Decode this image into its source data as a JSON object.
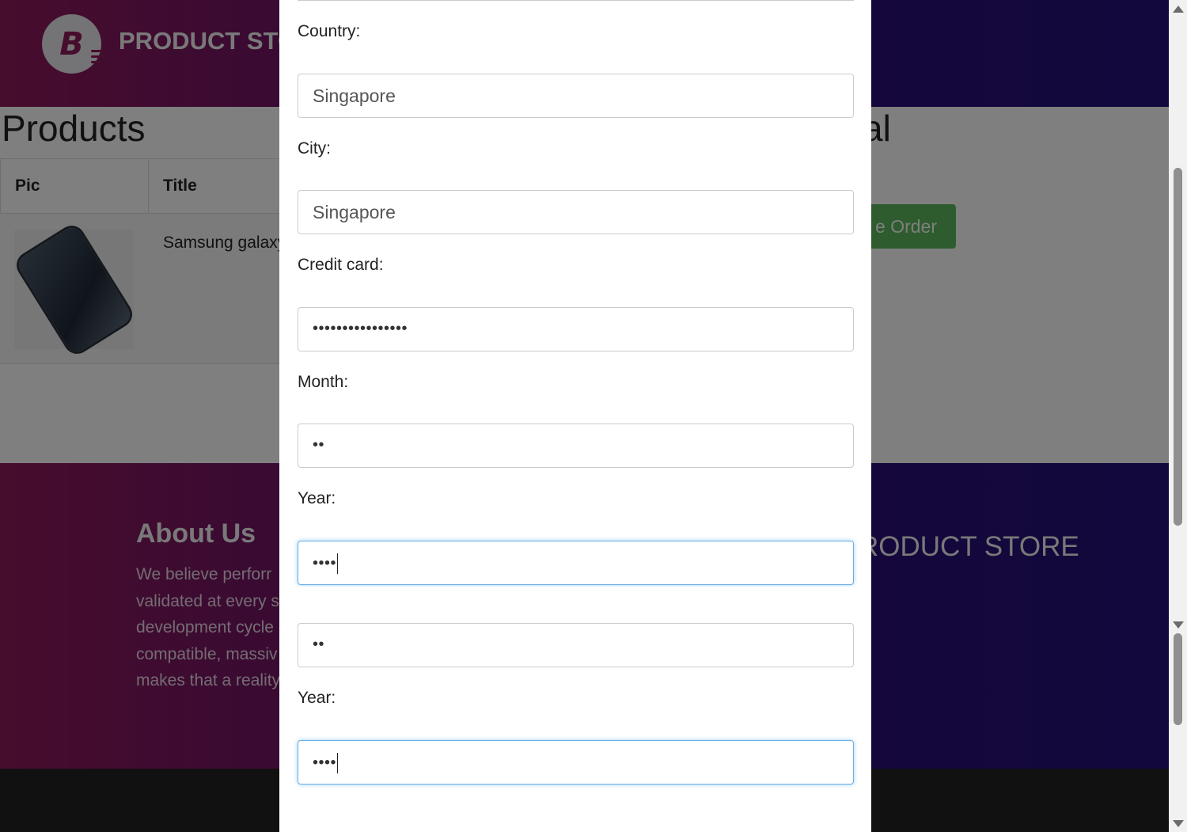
{
  "header": {
    "brand": "PRODUCT STORE",
    "logo_letter": "B"
  },
  "main": {
    "products_title": "Products",
    "total_title_fragment": "al",
    "table": {
      "columns": [
        "Pic",
        "Title"
      ],
      "rows": [
        {
          "title": "Samsung galaxy"
        }
      ]
    },
    "place_order_fragment": "e Order"
  },
  "footer": {
    "about_title": "About Us",
    "about_lines": [
      "We believe perforr",
      "validated at every s",
      "development cycle",
      "compatible, massiv",
      "makes that a reality"
    ],
    "brand_fragment": "RODUCT STORE"
  },
  "modal": {
    "fields": [
      {
        "label": "Country:",
        "value": "Singapore"
      },
      {
        "label": "City:",
        "value": "Singapore"
      },
      {
        "label": "Credit card:",
        "value": "••••••••••••••••"
      },
      {
        "label": "Month:",
        "value": "••"
      },
      {
        "label": "Year:",
        "value": "••••"
      }
    ],
    "duplicate_month_value": "••",
    "duplicate_year_label": "Year:",
    "duplicate_year_value": "••••"
  },
  "colors": {
    "accent_green": "#5cb85c",
    "focus_border": "#66afe9",
    "brand_magenta": "#8e1a5a",
    "brand_purple": "#25107a"
  }
}
